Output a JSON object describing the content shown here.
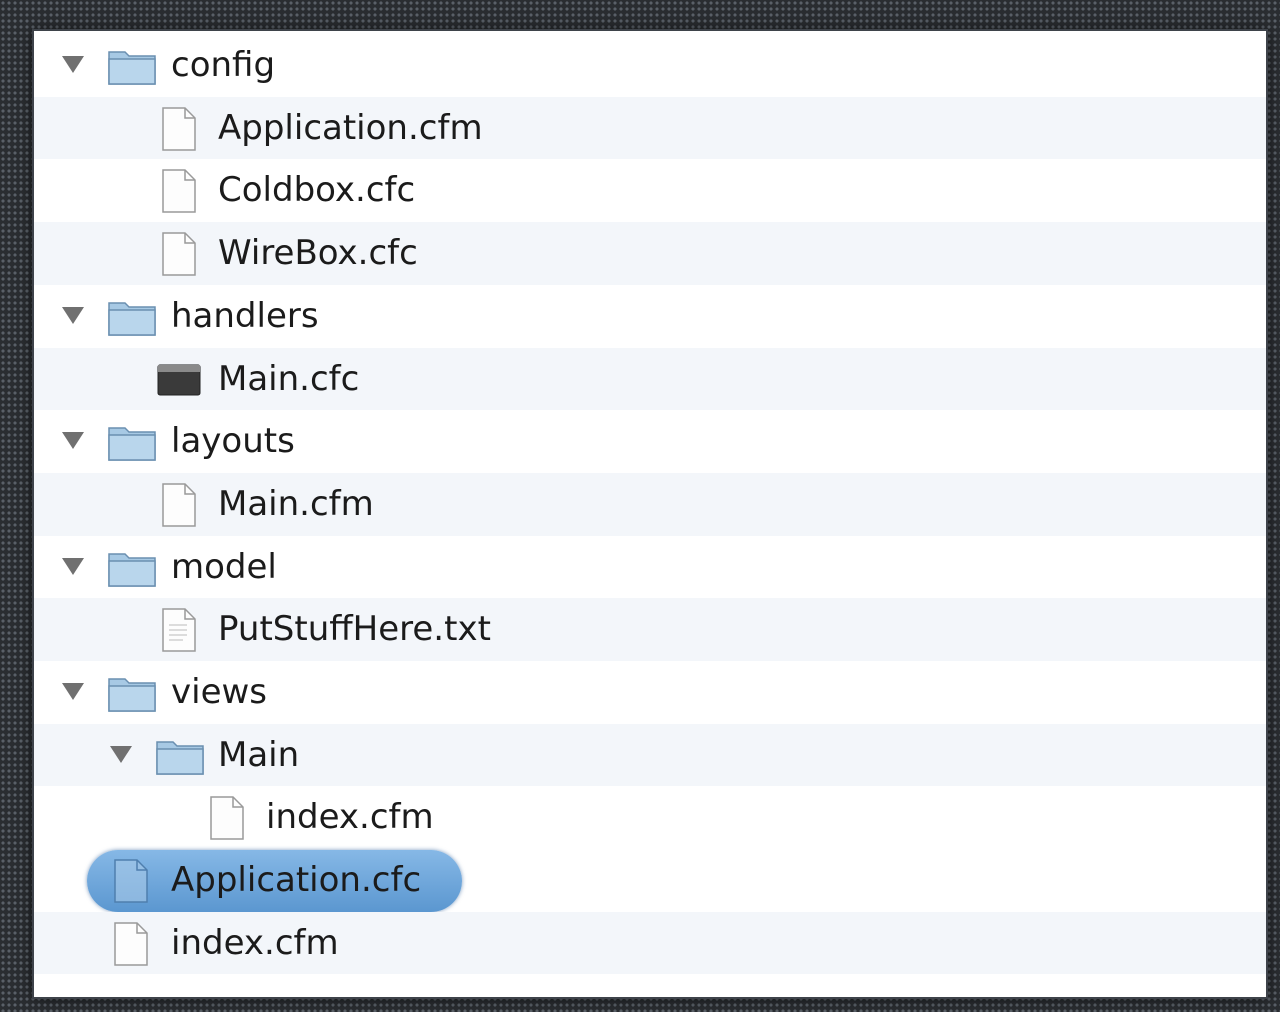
{
  "tree": {
    "rows": [
      {
        "name": "config",
        "kind": "folder",
        "depth": 0,
        "expanded": true
      },
      {
        "name": "Application.cfm",
        "kind": "file",
        "depth": 1
      },
      {
        "name": "Coldbox.cfc",
        "kind": "file",
        "depth": 1
      },
      {
        "name": "WireBox.cfc",
        "kind": "file",
        "depth": 1
      },
      {
        "name": "handlers",
        "kind": "folder",
        "depth": 0,
        "expanded": true
      },
      {
        "name": "Main.cfc",
        "kind": "executable",
        "depth": 1
      },
      {
        "name": "layouts",
        "kind": "folder",
        "depth": 0,
        "expanded": true
      },
      {
        "name": "Main.cfm",
        "kind": "file",
        "depth": 1
      },
      {
        "name": "model",
        "kind": "folder",
        "depth": 0,
        "expanded": true
      },
      {
        "name": "PutStuffHere.txt",
        "kind": "file",
        "depth": 1
      },
      {
        "name": "views",
        "kind": "folder",
        "depth": 0,
        "expanded": true
      },
      {
        "name": "Main",
        "kind": "folder",
        "depth": 1,
        "expanded": true
      },
      {
        "name": "index.cfm",
        "kind": "file",
        "depth": 2
      },
      {
        "name": "Application.cfc",
        "kind": "file",
        "depth": 0,
        "selected": true
      },
      {
        "name": "index.cfm",
        "kind": "file",
        "depth": 0
      }
    ]
  },
  "colors": {
    "selection": "#6aa6dc",
    "row_alt": "#f3f6fa",
    "folder": "#a9cbe6"
  }
}
